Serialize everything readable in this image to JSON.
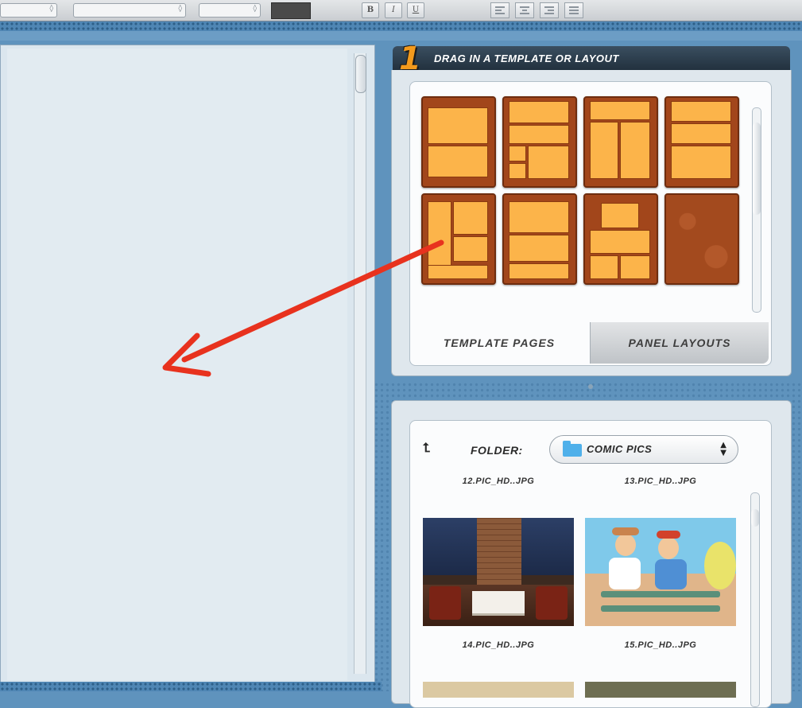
{
  "step": {
    "number": "1",
    "title": "DRAG IN A TEMPLATE OR LAYOUT"
  },
  "template_tabs": [
    {
      "label": "TEMPLATE PAGES",
      "active": true
    },
    {
      "label": "PANEL LAYOUTS",
      "active": false
    }
  ],
  "pictures": {
    "folder_label": "FOLDER:",
    "folder_value": "COMIC PICS",
    "files": [
      {
        "name": "12.PIC_HD..JPG"
      },
      {
        "name": "13.PIC_HD..JPG"
      },
      {
        "name": "14.PIC_HD..JPG"
      },
      {
        "name": "15.PIC_HD..JPG"
      }
    ]
  },
  "icons": {
    "up": "up-folder-icon",
    "folder": "folder-icon",
    "select_arrows": "updown-arrows-icon"
  },
  "toolbar": {
    "bold": "B",
    "italic": "I",
    "underline": "U"
  },
  "colors": {
    "accent_orange": "#f39a1d",
    "header_dark": "#22313e",
    "template_bg": "#a2461b",
    "panel_fill": "#fcb44a",
    "arrow_red": "#e8321e",
    "page_blue": "#5f93bd"
  }
}
